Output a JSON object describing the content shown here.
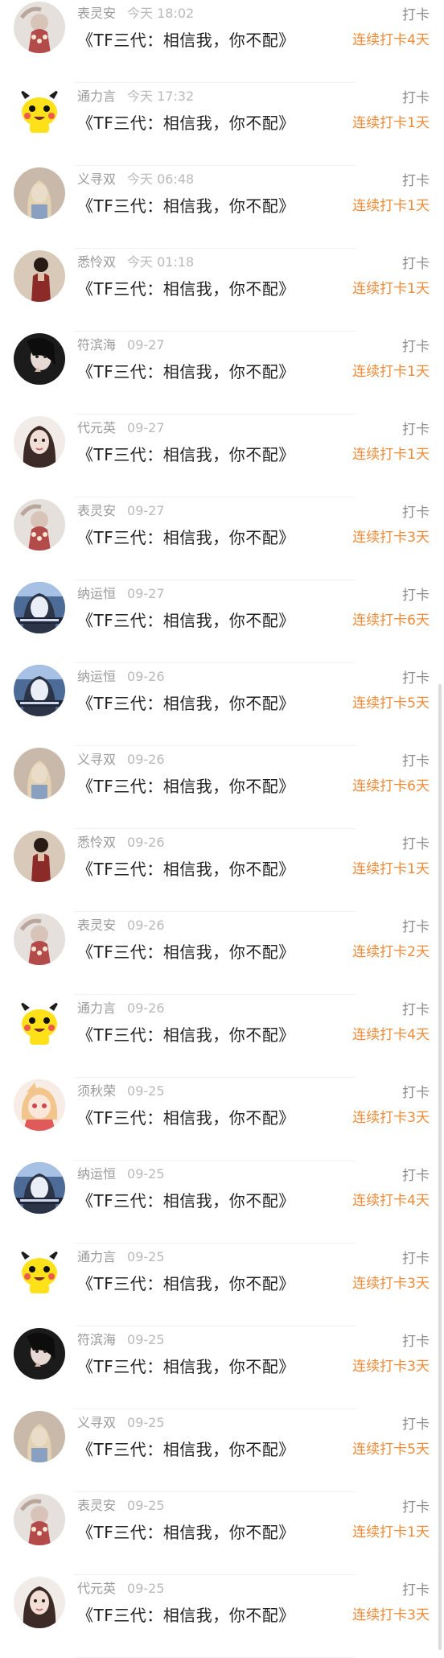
{
  "feed": {
    "items": [
      {
        "name": "表灵安",
        "time": "今天 18:02",
        "title": "《TF三代：相信我，你不配》",
        "action": "打卡",
        "streak": "连续打卡4天",
        "avatar": "avatar-dress"
      },
      {
        "name": "通力言",
        "time": "今天 17:32",
        "title": "《TF三代：相信我，你不配》",
        "action": "打卡",
        "streak": "连续打卡1天",
        "avatar": "avatar-pikachu"
      },
      {
        "name": "义寻双",
        "time": "今天 06:48",
        "title": "《TF三代：相信我，你不配》",
        "action": "打卡",
        "streak": "连续打卡1天",
        "avatar": "avatar-blonde"
      },
      {
        "name": "悉怜双",
        "time": "今天 01:18",
        "title": "《TF三代：相信我，你不配》",
        "action": "打卡",
        "streak": "连续打卡1天",
        "avatar": "avatar-redshirt"
      },
      {
        "name": "符滨海",
        "time": "09-27",
        "title": "《TF三代：相信我，你不配》",
        "action": "打卡",
        "streak": "连续打卡1天",
        "avatar": "avatar-darkgirl"
      },
      {
        "name": "代元英",
        "time": "09-27",
        "title": "《TF三代：相信我，你不配》",
        "action": "打卡",
        "streak": "连续打卡1天",
        "avatar": "avatar-brunette"
      },
      {
        "name": "表灵安",
        "time": "09-27",
        "title": "《TF三代：相信我，你不配》",
        "action": "打卡",
        "streak": "连续打卡3天",
        "avatar": "avatar-dress"
      },
      {
        "name": "纳运恒",
        "time": "09-27",
        "title": "《TF三代：相信我，你不配》",
        "action": "打卡",
        "streak": "连续打卡6天",
        "avatar": "avatar-bluegirl"
      },
      {
        "name": "纳运恒",
        "time": "09-26",
        "title": "《TF三代：相信我，你不配》",
        "action": "打卡",
        "streak": "连续打卡5天",
        "avatar": "avatar-bluegirl"
      },
      {
        "name": "义寻双",
        "time": "09-26",
        "title": "《TF三代：相信我，你不配》",
        "action": "打卡",
        "streak": "连续打卡6天",
        "avatar": "avatar-blonde"
      },
      {
        "name": "悉怜双",
        "time": "09-26",
        "title": "《TF三代：相信我，你不配》",
        "action": "打卡",
        "streak": "连续打卡1天",
        "avatar": "avatar-redshirt"
      },
      {
        "name": "表灵安",
        "time": "09-26",
        "title": "《TF三代：相信我，你不配》",
        "action": "打卡",
        "streak": "连续打卡2天",
        "avatar": "avatar-dress"
      },
      {
        "name": "通力言",
        "time": "09-26",
        "title": "《TF三代：相信我，你不配》",
        "action": "打卡",
        "streak": "连续打卡4天",
        "avatar": "avatar-pikachu"
      },
      {
        "name": "须秋荣",
        "time": "09-25",
        "title": "《TF三代：相信我，你不配》",
        "action": "打卡",
        "streak": "连续打卡3天",
        "avatar": "avatar-anime"
      },
      {
        "name": "纳运恒",
        "time": "09-25",
        "title": "《TF三代：相信我，你不配》",
        "action": "打卡",
        "streak": "连续打卡4天",
        "avatar": "avatar-bluegirl"
      },
      {
        "name": "通力言",
        "time": "09-25",
        "title": "《TF三代：相信我，你不配》",
        "action": "打卡",
        "streak": "连续打卡3天",
        "avatar": "avatar-pikachu"
      },
      {
        "name": "符滨海",
        "time": "09-25",
        "title": "《TF三代：相信我，你不配》",
        "action": "打卡",
        "streak": "连续打卡3天",
        "avatar": "avatar-darkgirl"
      },
      {
        "name": "义寻双",
        "time": "09-25",
        "title": "《TF三代：相信我，你不配》",
        "action": "打卡",
        "streak": "连续打卡5天",
        "avatar": "avatar-blonde"
      },
      {
        "name": "表灵安",
        "time": "09-25",
        "title": "《TF三代：相信我，你不配》",
        "action": "打卡",
        "streak": "连续打卡1天",
        "avatar": "avatar-dress"
      },
      {
        "name": "代元英",
        "time": "09-25",
        "title": "《TF三代：相信我，你不配》",
        "action": "打卡",
        "streak": "连续打卡3天",
        "avatar": "avatar-brunette"
      }
    ]
  },
  "colors": {
    "streak": "#ef8a37",
    "name": "#9a9a9a",
    "time": "#b9b9b9",
    "title": "#222222",
    "action": "#8b8b8b"
  }
}
